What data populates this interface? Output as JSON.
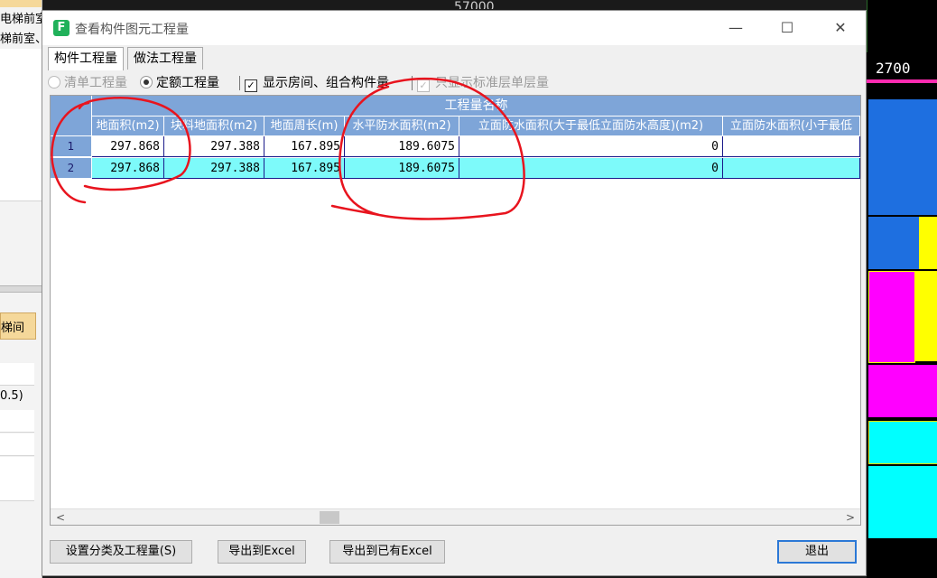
{
  "background_left": {
    "rows": [
      "电梯前室",
      "梯前室、"
    ],
    "lower_header": "梯间",
    "lower_value": "0.5)"
  },
  "background_right": {
    "dimension_label": "2700",
    "top_label": "57000"
  },
  "dialog": {
    "title": "查看构件图元工程量",
    "window_buttons": {
      "minimize": "—",
      "maximize": "☐",
      "close": "✕"
    },
    "tabs": [
      {
        "label": "构件工程量",
        "active": true
      },
      {
        "label": "做法工程量",
        "active": false
      }
    ],
    "options": {
      "bill_quantity": {
        "label": "清单工程量",
        "checked": false,
        "disabled": true
      },
      "quota_quantity": {
        "label": "定额工程量",
        "checked": true,
        "disabled": false
      },
      "show_room_combo": {
        "label": "显示房间、组合构件量",
        "checked": true,
        "disabled": false
      },
      "standard_floor_only": {
        "label": "只显示标准层单层量",
        "checked": true,
        "disabled": true
      }
    },
    "table": {
      "group_header": "工程量名称",
      "columns": [
        "地面积(m2)",
        "块料地面积(m2)",
        "地面周长(m)",
        "水平防水面积(m2)",
        "立面防水面积(大于最低立面防水高度)(m2)",
        "立面防水面积(小于最低"
      ],
      "rows": [
        {
          "index": "1",
          "values": [
            "297.868",
            "297.388",
            "167.895",
            "189.6075",
            "0",
            ""
          ],
          "selected": false
        },
        {
          "index": "2",
          "values": [
            "297.868",
            "297.388",
            "167.895",
            "189.6075",
            "0",
            ""
          ],
          "selected": true
        }
      ]
    },
    "scroll": {
      "left": "<",
      "right": ">"
    },
    "buttons": {
      "settings": "设置分类及工程量(S)",
      "export_excel": "导出到Excel",
      "export_existing_excel": "导出到已有Excel",
      "exit": "退出"
    }
  },
  "colors": {
    "header_blue": "#7ea5d8",
    "selected_row": "#7dfafa",
    "annotation_red": "#e8141e",
    "cad_blue": "#1e6fe0",
    "cad_magenta": "#ff00ff",
    "cad_cyan": "#00ffff",
    "cad_yellow": "#ffff00"
  }
}
